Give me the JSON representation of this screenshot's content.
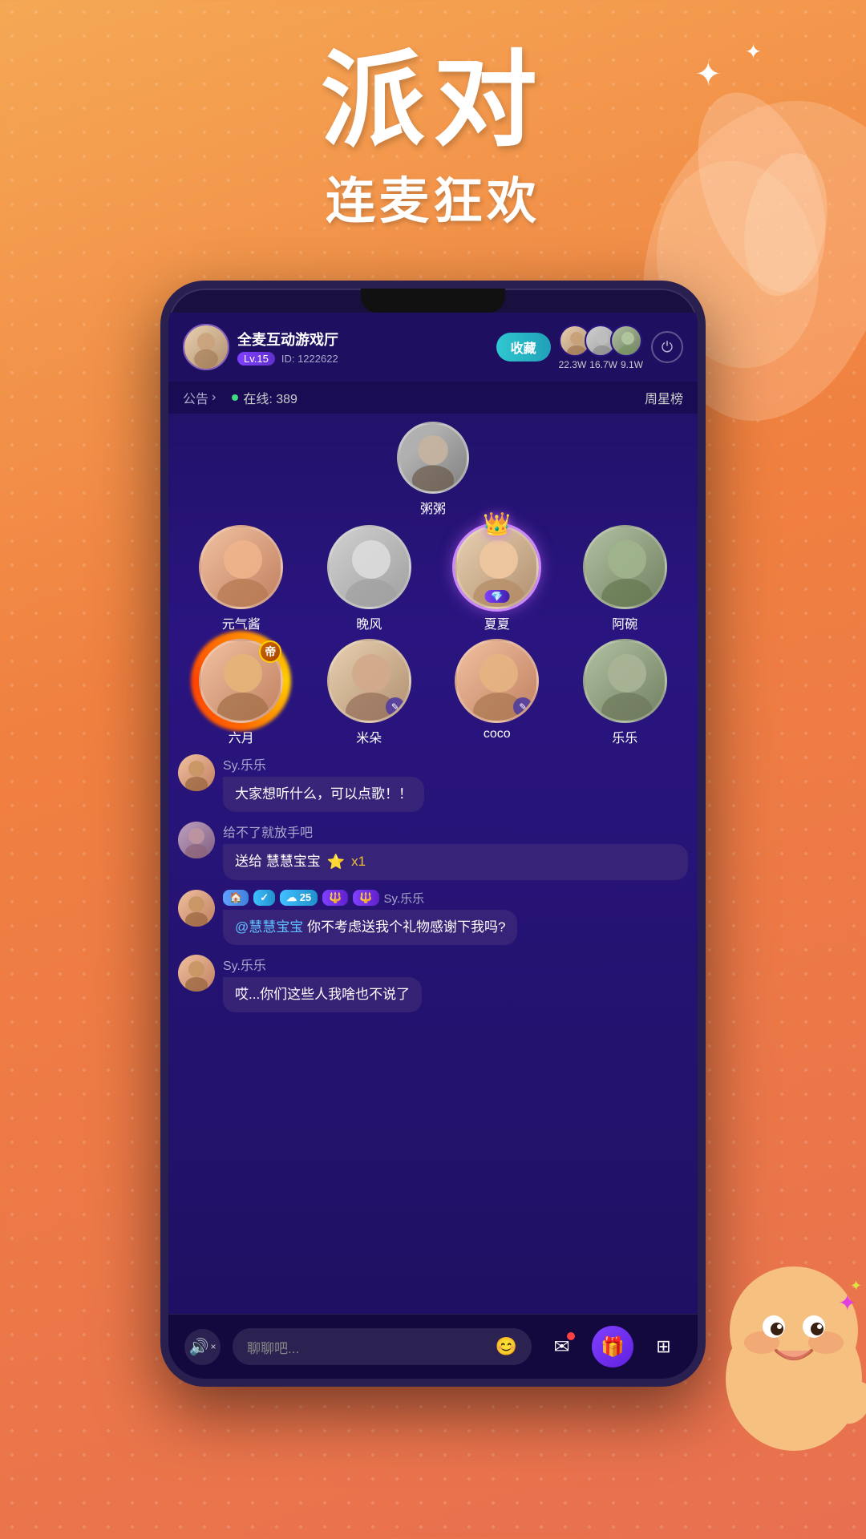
{
  "app": {
    "background_gradient": "linear-gradient(160deg, #f5a855 0%, #f08040 40%, #e87050 100%)"
  },
  "hero": {
    "main_title": "派对",
    "sub_title": "连麦狂欢",
    "sparkle_1": "✦",
    "sparkle_2": "✦"
  },
  "phone": {
    "host": {
      "name": "全麦互动游戏厅",
      "level": "Lv.15",
      "id": "ID: 1222622",
      "collect_label": "收藏",
      "announce_label": "公告",
      "announce_arrow": ">",
      "online_label": "在线: 389",
      "weekly_rank_label": "周星榜"
    },
    "viewers": [
      {
        "count": "22.3W",
        "color": "#c0a080"
      },
      {
        "count": "16.7W",
        "color": "#9090a0"
      },
      {
        "count": "9.1W",
        "color": "#a09070"
      }
    ],
    "stage": {
      "host_name": "粥粥"
    },
    "row1_performers": [
      {
        "name": "元气酱",
        "color": "#f0c0a0"
      },
      {
        "name": "晚风",
        "color": "#d0d0d0"
      },
      {
        "name": "夏夏",
        "color": "#e8d0b0",
        "special": true
      },
      {
        "name": "阿碗",
        "color": "#808060"
      }
    ],
    "row2_performers": [
      {
        "name": "六月",
        "color": "#c09060",
        "emperor": true
      },
      {
        "name": "米朵",
        "color": "#c0a090",
        "muted": true
      },
      {
        "name": "coco",
        "color": "#d0a070",
        "muted": true
      },
      {
        "name": "乐乐",
        "color": "#a0a080"
      }
    ],
    "chat_messages": [
      {
        "username": "Sy.乐乐",
        "text": "大家想听什么，可以点歌！！",
        "type": "normal",
        "avatar_color": "#c09060"
      },
      {
        "username": "给不了就放手吧",
        "gift_text": "送给 慧慧宝宝",
        "gift_icon": "⭐",
        "gift_count": "x1",
        "type": "gift",
        "avatar_color": "#b08070"
      },
      {
        "username": "Sy.乐乐",
        "badges": [
          "🏠",
          "✓",
          "25",
          "🔱",
          "🔱"
        ],
        "mention": "@慧慧宝宝",
        "text": " 你不考虑送我个礼物感谢下我吗?",
        "type": "mention",
        "avatar_color": "#c09060"
      },
      {
        "username": "Sy.乐乐",
        "text": "哎...你们这些人我啥也不说了",
        "type": "normal",
        "avatar_color": "#c09060"
      }
    ],
    "bottom_bar": {
      "chat_placeholder": "聊聊吧...",
      "sound_icon": "🔊",
      "emoji_icon": "😊",
      "mail_icon": "✉",
      "gift_icon": "🎁",
      "menu_icon": "⊞"
    }
  }
}
